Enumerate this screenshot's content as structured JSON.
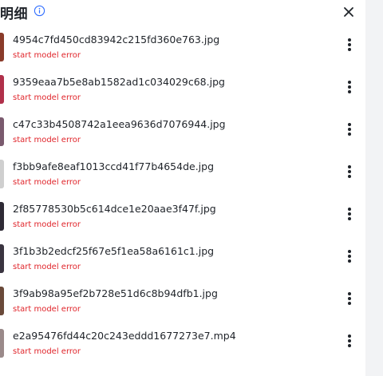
{
  "header": {
    "title": "明细",
    "info_icon": "info-circle-icon",
    "close_icon": "close-icon"
  },
  "files": [
    {
      "name": "4954c7fd450cd83942c215fd360e763.jpg",
      "status": "start model error",
      "thumb_color": "#8a3b2a"
    },
    {
      "name": "9359eaa7b5e8ab1582ad1c034029c68.jpg",
      "status": "start model error",
      "thumb_color": "#b0304a"
    },
    {
      "name": "c47c33b4508742a1eea9636d7076944.jpg",
      "status": "start model error",
      "thumb_color": "#7a5a6e"
    },
    {
      "name": "f3bb9afe8eaf1013ccd41f77b4654de.jpg",
      "status": "start model error",
      "thumb_color": "#cfcfcf"
    },
    {
      "name": "2f85778530b5c614dce1e20aae3f47f.jpg",
      "status": "start model error",
      "thumb_color": "#2e2a35"
    },
    {
      "name": "3f1b3b2edcf25f67e5f1ea58a6161c1.jpg",
      "status": "start model error",
      "thumb_color": "#3a3440"
    },
    {
      "name": "3f9ab98a95ef2b728e51d6c8b94dfb1.jpg",
      "status": "start model error",
      "thumb_color": "#6a4a3a"
    },
    {
      "name": "e2a95476fd44c20c243eddd1677273e7.mp4",
      "status": "start model error",
      "thumb_color": "#9a8a8a"
    }
  ],
  "colors": {
    "error": "#e0252b",
    "text": "#1f2329",
    "icon_accent": "#3370ff"
  }
}
